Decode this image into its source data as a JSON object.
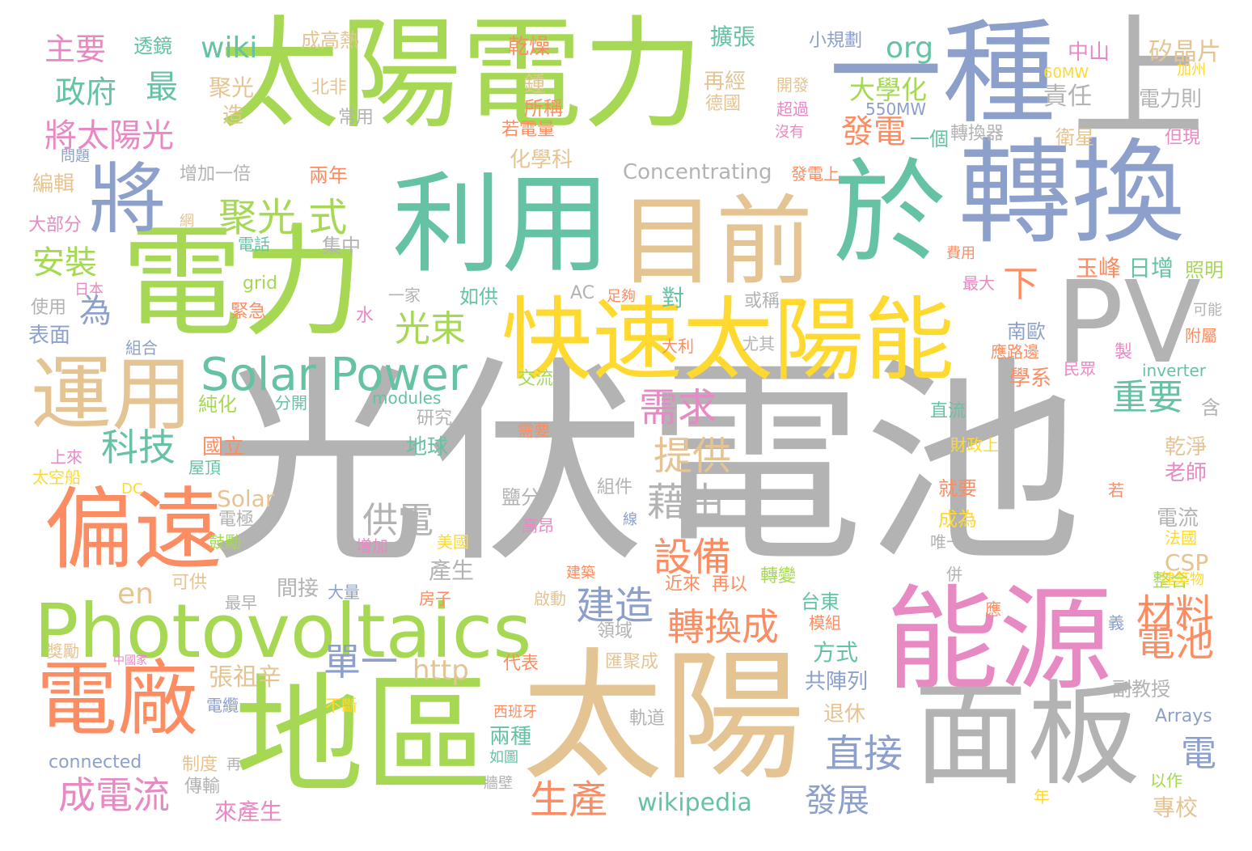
{
  "palette": {
    "gray": "#b3b3b3",
    "green": "#a6d854",
    "teal": "#66c2a5",
    "blue": "#8da0cb",
    "orange": "#fc8d62",
    "pink": "#e78ac3",
    "yellow": "#ffd92f",
    "tan": "#e5c494"
  },
  "words": [
    {
      "text": "光伏電池",
      "color": "gray"
    },
    {
      "text": "太陽電力",
      "color": "green"
    },
    {
      "text": "太陽",
      "color": "tan"
    },
    {
      "text": "電力",
      "color": "green"
    },
    {
      "text": "一種",
      "color": "blue"
    },
    {
      "text": "上",
      "color": "gray"
    },
    {
      "text": "利用",
      "color": "teal"
    },
    {
      "text": "目前",
      "color": "tan"
    },
    {
      "text": "於",
      "color": "teal"
    },
    {
      "text": "轉換",
      "color": "blue"
    },
    {
      "text": "將",
      "color": "blue"
    },
    {
      "text": "PV",
      "color": "gray"
    },
    {
      "text": "快速太陽能",
      "color": "yellow"
    },
    {
      "text": "運用",
      "color": "tan"
    },
    {
      "text": "偏遠",
      "color": "orange"
    },
    {
      "text": "Photovoltaics",
      "color": "green"
    },
    {
      "text": "地區",
      "color": "green"
    },
    {
      "text": "能源",
      "color": "pink"
    },
    {
      "text": "面板",
      "color": "gray"
    },
    {
      "text": "電廠",
      "color": "orange"
    },
    {
      "text": "Solar Power",
      "color": "teal"
    },
    {
      "text": "主要",
      "color": "pink"
    },
    {
      "text": "透鏡",
      "color": "teal"
    },
    {
      "text": "wiki",
      "color": "teal"
    },
    {
      "text": "成高熱",
      "color": "tan"
    },
    {
      "text": "乾燥",
      "color": "orange"
    },
    {
      "text": "擴張",
      "color": "teal"
    },
    {
      "text": "小規劃",
      "color": "blue"
    },
    {
      "text": "org",
      "color": "teal"
    },
    {
      "text": "中山",
      "color": "pink"
    },
    {
      "text": "矽晶片",
      "color": "tan"
    },
    {
      "text": "政府",
      "color": "teal"
    },
    {
      "text": "最",
      "color": "teal"
    },
    {
      "text": "聚光",
      "color": "tan"
    },
    {
      "text": "北非",
      "color": "tan"
    },
    {
      "text": "鍾",
      "color": "tan"
    },
    {
      "text": "再經",
      "color": "tan"
    },
    {
      "text": "開發",
      "color": "tan"
    },
    {
      "text": "60MW",
      "color": "yellow"
    },
    {
      "text": "加州",
      "color": "yellow"
    },
    {
      "text": "大學化",
      "color": "green"
    },
    {
      "text": "責任",
      "color": "gray"
    },
    {
      "text": "電力則",
      "color": "gray"
    },
    {
      "text": "將太陽光",
      "color": "pink"
    },
    {
      "text": "造",
      "color": "tan"
    },
    {
      "text": "常用",
      "color": "gray"
    },
    {
      "text": "所稱",
      "color": "orange"
    },
    {
      "text": "德國",
      "color": "tan"
    },
    {
      "text": "超過",
      "color": "pink"
    },
    {
      "text": "550MW",
      "color": "blue"
    },
    {
      "text": "問題",
      "color": "blue"
    },
    {
      "text": "若電量",
      "color": "orange"
    },
    {
      "text": "沒有",
      "color": "pink"
    },
    {
      "text": "發電",
      "color": "orange"
    },
    {
      "text": "一個",
      "color": "teal"
    },
    {
      "text": "轉換器",
      "color": "gray"
    },
    {
      "text": "衛星",
      "color": "tan"
    },
    {
      "text": "但現",
      "color": "pink"
    },
    {
      "text": "編輯",
      "color": "tan"
    },
    {
      "text": "增加一倍",
      "color": "gray"
    },
    {
      "text": "化學科",
      "color": "tan"
    },
    {
      "text": "兩年",
      "color": "orange"
    },
    {
      "text": "Concentrating",
      "color": "gray"
    },
    {
      "text": "發電上",
      "color": "orange"
    },
    {
      "text": "聚光 式",
      "color": "green"
    },
    {
      "text": "大部分",
      "color": "pink"
    },
    {
      "text": "網",
      "color": "tan"
    },
    {
      "text": "安裝",
      "color": "green"
    },
    {
      "text": "電話",
      "color": "teal"
    },
    {
      "text": "集中",
      "color": "gray"
    },
    {
      "text": "費用",
      "color": "orange"
    },
    {
      "text": "grid",
      "color": "green"
    },
    {
      "text": "日本",
      "color": "pink"
    },
    {
      "text": "為",
      "color": "blue"
    },
    {
      "text": "緊急",
      "color": "orange"
    },
    {
      "text": "一家",
      "color": "gray"
    },
    {
      "text": "如供",
      "color": "teal"
    },
    {
      "text": "AC",
      "color": "gray"
    },
    {
      "text": "足夠",
      "color": "orange"
    },
    {
      "text": "對",
      "color": "teal"
    },
    {
      "text": "或稱",
      "color": "gray"
    },
    {
      "text": "最大",
      "color": "pink"
    },
    {
      "text": "下",
      "color": "orange"
    },
    {
      "text": "玉峰",
      "color": "orange"
    },
    {
      "text": "日增",
      "color": "teal"
    },
    {
      "text": "照明",
      "color": "green"
    },
    {
      "text": "使用",
      "color": "gray"
    },
    {
      "text": "表面",
      "color": "blue"
    },
    {
      "text": "水",
      "color": "pink"
    },
    {
      "text": "光束",
      "color": "green"
    },
    {
      "text": "可能",
      "color": "gray"
    },
    {
      "text": "附屬",
      "color": "orange"
    },
    {
      "text": "組合",
      "color": "blue"
    },
    {
      "text": "大利",
      "color": "orange"
    },
    {
      "text": "尤其",
      "color": "gray"
    },
    {
      "text": "南歐",
      "color": "blue"
    },
    {
      "text": "應路邊",
      "color": "orange"
    },
    {
      "text": "民眾",
      "color": "pink"
    },
    {
      "text": "製",
      "color": "pink"
    },
    {
      "text": "科技",
      "color": "teal"
    },
    {
      "text": "需求",
      "color": "pink"
    },
    {
      "text": "純化",
      "color": "green"
    },
    {
      "text": "分開",
      "color": "teal"
    },
    {
      "text": "modules",
      "color": "teal"
    },
    {
      "text": "交流",
      "color": "green"
    },
    {
      "text": "學系",
      "color": "orange"
    },
    {
      "text": "inverter",
      "color": "teal"
    },
    {
      "text": "重要",
      "color": "teal"
    },
    {
      "text": "研究",
      "color": "gray"
    },
    {
      "text": "直流",
      "color": "teal"
    },
    {
      "text": "含",
      "color": "gray"
    },
    {
      "text": "提供",
      "color": "tan"
    },
    {
      "text": "需要",
      "color": "orange"
    },
    {
      "text": "國立",
      "color": "orange"
    },
    {
      "text": "地球",
      "color": "teal"
    },
    {
      "text": "乾淨",
      "color": "tan"
    },
    {
      "text": "上來",
      "color": "pink"
    },
    {
      "text": "屋頂",
      "color": "teal"
    },
    {
      "text": "財政上",
      "color": "yellow"
    },
    {
      "text": "老師",
      "color": "pink"
    },
    {
      "text": "太空船",
      "color": "yellow"
    },
    {
      "text": "DC",
      "color": "yellow"
    },
    {
      "text": "Solar",
      "color": "tan"
    },
    {
      "text": "藉由",
      "color": "gray"
    },
    {
      "text": "鹽分",
      "color": "gray"
    },
    {
      "text": "組件",
      "color": "gray"
    },
    {
      "text": "就要",
      "color": "orange"
    },
    {
      "text": "若",
      "color": "orange"
    },
    {
      "text": "供電",
      "color": "gray"
    },
    {
      "text": "電極",
      "color": "gray"
    },
    {
      "text": "線",
      "color": "blue"
    },
    {
      "text": "成為",
      "color": "yellow"
    },
    {
      "text": "電流",
      "color": "gray"
    },
    {
      "text": "鼓勵",
      "color": "green"
    },
    {
      "text": "增加",
      "color": "pink"
    },
    {
      "text": "美國",
      "color": "yellow"
    },
    {
      "text": "高昂",
      "color": "pink"
    },
    {
      "text": "唯一",
      "color": "gray"
    },
    {
      "text": "法國",
      "color": "yellow"
    },
    {
      "text": "設備",
      "color": "orange"
    },
    {
      "text": "產生",
      "color": "gray"
    },
    {
      "text": "CSP",
      "color": "tan"
    },
    {
      "text": "可供",
      "color": "tan"
    },
    {
      "text": "間接",
      "color": "gray"
    },
    {
      "text": "建築",
      "color": "orange"
    },
    {
      "text": "近來",
      "color": "orange"
    },
    {
      "text": "再以",
      "color": "orange"
    },
    {
      "text": "轉變",
      "color": "green"
    },
    {
      "text": "併",
      "color": "gray"
    },
    {
      "text": "整合",
      "color": "green"
    },
    {
      "text": "建築物",
      "color": "yellow"
    },
    {
      "text": "en",
      "color": "tan"
    },
    {
      "text": "最早",
      "color": "gray"
    },
    {
      "text": "大量",
      "color": "blue"
    },
    {
      "text": "房子",
      "color": "orange"
    },
    {
      "text": "啟動",
      "color": "tan"
    },
    {
      "text": "建造",
      "color": "blue"
    },
    {
      "text": "台東",
      "color": "teal"
    },
    {
      "text": "應",
      "color": "orange"
    },
    {
      "text": "材料",
      "color": "orange"
    },
    {
      "text": "轉換成",
      "color": "orange"
    },
    {
      "text": "模組",
      "color": "orange"
    },
    {
      "text": "義",
      "color": "blue"
    },
    {
      "text": "獎勵",
      "color": "tan"
    },
    {
      "text": "領域",
      "color": "gray"
    },
    {
      "text": "電池",
      "color": "orange"
    },
    {
      "text": "中國家",
      "color": "pink"
    },
    {
      "text": "http",
      "color": "tan"
    },
    {
      "text": "代表",
      "color": "orange"
    },
    {
      "text": "匯聚成",
      "color": "tan"
    },
    {
      "text": "方式",
      "color": "teal"
    },
    {
      "text": "張祖辛",
      "color": "tan"
    },
    {
      "text": "單一",
      "color": "blue"
    },
    {
      "text": "共陣列",
      "color": "blue"
    },
    {
      "text": "副教授",
      "color": "gray"
    },
    {
      "text": "電纜",
      "color": "blue"
    },
    {
      "text": "不斷",
      "color": "yellow"
    },
    {
      "text": "西班牙",
      "color": "orange"
    },
    {
      "text": "軌道",
      "color": "gray"
    },
    {
      "text": "退休",
      "color": "tan"
    },
    {
      "text": "Arrays",
      "color": "blue"
    },
    {
      "text": "connected",
      "color": "blue"
    },
    {
      "text": "兩種",
      "color": "teal"
    },
    {
      "text": "如圖",
      "color": "teal"
    },
    {
      "text": "電",
      "color": "blue"
    },
    {
      "text": "制度",
      "color": "tan"
    },
    {
      "text": "再",
      "color": "gray"
    },
    {
      "text": "直接",
      "color": "blue"
    },
    {
      "text": "成電流",
      "color": "pink"
    },
    {
      "text": "傳輸",
      "color": "gray"
    },
    {
      "text": "牆壁",
      "color": "gray"
    },
    {
      "text": "以作",
      "color": "green"
    },
    {
      "text": "生產",
      "color": "orange"
    },
    {
      "text": "wikipedia",
      "color": "teal"
    },
    {
      "text": "發展",
      "color": "blue"
    },
    {
      "text": "年",
      "color": "yellow"
    },
    {
      "text": "來產生",
      "color": "pink"
    },
    {
      "text": "專校",
      "color": "tan"
    }
  ]
}
